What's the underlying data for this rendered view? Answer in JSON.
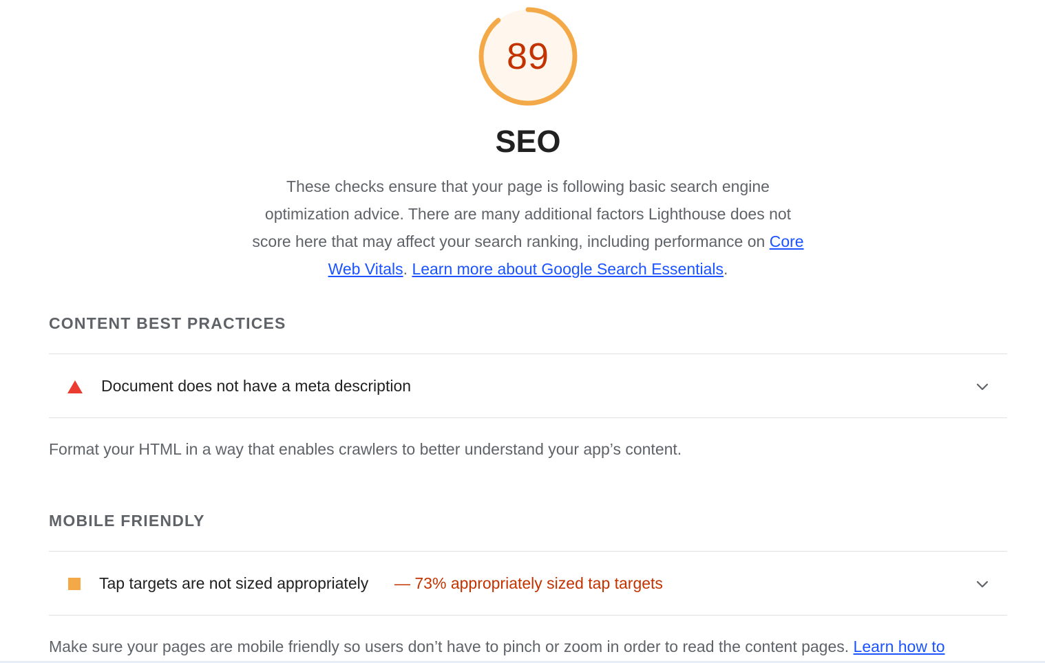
{
  "category": {
    "score": "89",
    "score_fraction": 0.89,
    "title": "SEO",
    "description_text": "These checks ensure that your page is following basic search engine optimization advice. There are many additional factors Lighthouse does not score here that may affect your search ranking, including performance on ",
    "link_core_web_vitals": "Core Web Vitals",
    "separator": ". ",
    "link_learn_more": "Learn more about Google Search Essentials",
    "end_punct": ".",
    "colors": {
      "average": "#f4a948",
      "average_bg": "#fff7ee",
      "score_text": "#c33300",
      "fail": "#eb3c32",
      "link": "#1a53ff"
    }
  },
  "groups": [
    {
      "title": "CONTENT BEST PRACTICES",
      "audit": {
        "icon": "fail-triangle-icon",
        "title": "Document does not have a meta description",
        "display_value": ""
      },
      "description": "Format your HTML in a way that enables crawlers to better understand your app’s content.",
      "link": ""
    },
    {
      "title": "MOBILE FRIENDLY",
      "audit": {
        "icon": "average-square-icon",
        "title": "Tap targets are not sized appropriately",
        "display_value": "— 73% appropriately sized tap targets"
      },
      "description": "Make sure your pages are mobile friendly so users don’t have to pinch or zoom in order to read the content pages. ",
      "link": "Learn how to"
    }
  ]
}
